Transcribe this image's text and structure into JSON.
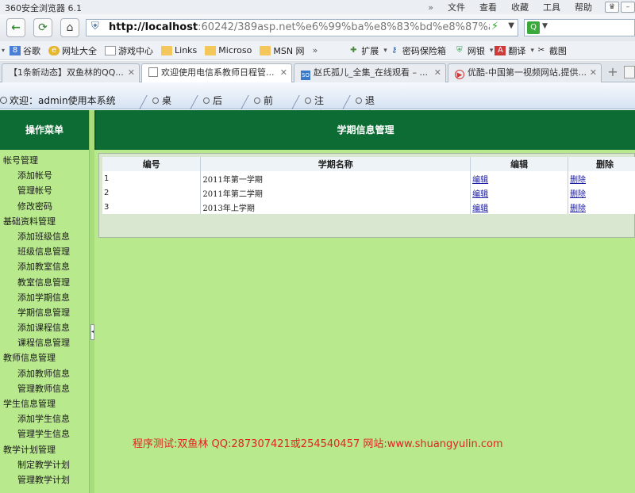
{
  "browser": {
    "title": "360安全浏览器 6.1",
    "menu": [
      "文件",
      "查看",
      "收藏",
      "工具",
      "帮助"
    ],
    "url_host": "http://localhost",
    "url_rest": ":60242/389asp.net%e6%99%ba%e8%83%bd%e8%87%a",
    "favorites": [
      {
        "label": "谷歌",
        "icon": "google-icon"
      },
      {
        "label": "网址大全",
        "icon": "web-directory-icon"
      },
      {
        "label": "游戏中心",
        "icon": "page-icon"
      },
      {
        "label": "Links",
        "icon": "folder-icon"
      },
      {
        "label": "Microso",
        "icon": "folder-icon"
      },
      {
        "label": "MSN 网",
        "icon": "folder-icon"
      }
    ],
    "favorites_more": "»",
    "extensions": [
      {
        "label": "扩展",
        "icon": "extension-icon"
      },
      {
        "label": "密码保险箱",
        "icon": "key-icon"
      },
      {
        "label": "网银",
        "icon": "shield-icon"
      },
      {
        "label": "翻译",
        "icon": "translate-icon"
      },
      {
        "label": "截图",
        "icon": "screenshot-icon"
      }
    ],
    "tabs": [
      {
        "label": "【1条新动态】双鱼林的QQ..."
      },
      {
        "label": "欢迎使用电信系教师日程管..."
      },
      {
        "label": "赵氏孤儿_全集_在线观看 – ..."
      },
      {
        "label": "优酷-中国第一视频网站,提供..."
      }
    ]
  },
  "app": {
    "welcome": "欢迎：admin使用本系统",
    "nav": [
      "桌面",
      "后退",
      "前进",
      "注销",
      "退出"
    ],
    "sidebar_title": "操作菜单",
    "menu": [
      {
        "group": "帐号管理",
        "items": [
          "添加帐号",
          "管理帐号",
          "修改密码"
        ]
      },
      {
        "group": "基础资料管理",
        "items": [
          "添加班级信息",
          "班级信息管理",
          "添加教室信息",
          "教室信息管理",
          "添加学期信息",
          "学期信息管理",
          "添加课程信息",
          "课程信息管理"
        ]
      },
      {
        "group": "教师信息管理",
        "items": [
          "添加教师信息",
          "管理教师信息"
        ]
      },
      {
        "group": "学生信息管理",
        "items": [
          "添加学生信息",
          "管理学生信息"
        ]
      },
      {
        "group": "教学计划管理",
        "items": [
          "制定教学计划",
          "管理教学计划"
        ]
      }
    ],
    "page_title": "学期信息管理",
    "table": {
      "columns": [
        "编号",
        "学期名称",
        "编辑",
        "删除"
      ],
      "rows": [
        {
          "id": "1",
          "name": "2011年第一学期",
          "edit": "编辑",
          "delete": "删除"
        },
        {
          "id": "2",
          "name": "2011年第二学期",
          "edit": "编辑",
          "delete": "删除"
        },
        {
          "id": "3",
          "name": "2013年上学期",
          "edit": "编辑",
          "delete": "删除"
        }
      ]
    },
    "credit": "程序测试:双鱼林 QQ:287307421或254540457 网站:www.shuangyulin.com"
  }
}
